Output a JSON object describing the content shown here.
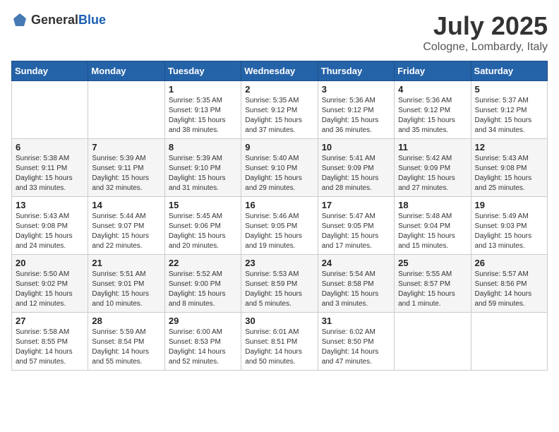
{
  "header": {
    "logo": {
      "general": "General",
      "blue": "Blue"
    },
    "title": "July 2025",
    "location": "Cologne, Lombardy, Italy"
  },
  "calendar": {
    "weekdays": [
      "Sunday",
      "Monday",
      "Tuesday",
      "Wednesday",
      "Thursday",
      "Friday",
      "Saturday"
    ],
    "weeks": [
      [
        {
          "day": "",
          "info": ""
        },
        {
          "day": "",
          "info": ""
        },
        {
          "day": "1",
          "info": "Sunrise: 5:35 AM\nSunset: 9:13 PM\nDaylight: 15 hours\nand 38 minutes."
        },
        {
          "day": "2",
          "info": "Sunrise: 5:35 AM\nSunset: 9:12 PM\nDaylight: 15 hours\nand 37 minutes."
        },
        {
          "day": "3",
          "info": "Sunrise: 5:36 AM\nSunset: 9:12 PM\nDaylight: 15 hours\nand 36 minutes."
        },
        {
          "day": "4",
          "info": "Sunrise: 5:36 AM\nSunset: 9:12 PM\nDaylight: 15 hours\nand 35 minutes."
        },
        {
          "day": "5",
          "info": "Sunrise: 5:37 AM\nSunset: 9:12 PM\nDaylight: 15 hours\nand 34 minutes."
        }
      ],
      [
        {
          "day": "6",
          "info": "Sunrise: 5:38 AM\nSunset: 9:11 PM\nDaylight: 15 hours\nand 33 minutes."
        },
        {
          "day": "7",
          "info": "Sunrise: 5:39 AM\nSunset: 9:11 PM\nDaylight: 15 hours\nand 32 minutes."
        },
        {
          "day": "8",
          "info": "Sunrise: 5:39 AM\nSunset: 9:10 PM\nDaylight: 15 hours\nand 31 minutes."
        },
        {
          "day": "9",
          "info": "Sunrise: 5:40 AM\nSunset: 9:10 PM\nDaylight: 15 hours\nand 29 minutes."
        },
        {
          "day": "10",
          "info": "Sunrise: 5:41 AM\nSunset: 9:09 PM\nDaylight: 15 hours\nand 28 minutes."
        },
        {
          "day": "11",
          "info": "Sunrise: 5:42 AM\nSunset: 9:09 PM\nDaylight: 15 hours\nand 27 minutes."
        },
        {
          "day": "12",
          "info": "Sunrise: 5:43 AM\nSunset: 9:08 PM\nDaylight: 15 hours\nand 25 minutes."
        }
      ],
      [
        {
          "day": "13",
          "info": "Sunrise: 5:43 AM\nSunset: 9:08 PM\nDaylight: 15 hours\nand 24 minutes."
        },
        {
          "day": "14",
          "info": "Sunrise: 5:44 AM\nSunset: 9:07 PM\nDaylight: 15 hours\nand 22 minutes."
        },
        {
          "day": "15",
          "info": "Sunrise: 5:45 AM\nSunset: 9:06 PM\nDaylight: 15 hours\nand 20 minutes."
        },
        {
          "day": "16",
          "info": "Sunrise: 5:46 AM\nSunset: 9:05 PM\nDaylight: 15 hours\nand 19 minutes."
        },
        {
          "day": "17",
          "info": "Sunrise: 5:47 AM\nSunset: 9:05 PM\nDaylight: 15 hours\nand 17 minutes."
        },
        {
          "day": "18",
          "info": "Sunrise: 5:48 AM\nSunset: 9:04 PM\nDaylight: 15 hours\nand 15 minutes."
        },
        {
          "day": "19",
          "info": "Sunrise: 5:49 AM\nSunset: 9:03 PM\nDaylight: 15 hours\nand 13 minutes."
        }
      ],
      [
        {
          "day": "20",
          "info": "Sunrise: 5:50 AM\nSunset: 9:02 PM\nDaylight: 15 hours\nand 12 minutes."
        },
        {
          "day": "21",
          "info": "Sunrise: 5:51 AM\nSunset: 9:01 PM\nDaylight: 15 hours\nand 10 minutes."
        },
        {
          "day": "22",
          "info": "Sunrise: 5:52 AM\nSunset: 9:00 PM\nDaylight: 15 hours\nand 8 minutes."
        },
        {
          "day": "23",
          "info": "Sunrise: 5:53 AM\nSunset: 8:59 PM\nDaylight: 15 hours\nand 5 minutes."
        },
        {
          "day": "24",
          "info": "Sunrise: 5:54 AM\nSunset: 8:58 PM\nDaylight: 15 hours\nand 3 minutes."
        },
        {
          "day": "25",
          "info": "Sunrise: 5:55 AM\nSunset: 8:57 PM\nDaylight: 15 hours\nand 1 minute."
        },
        {
          "day": "26",
          "info": "Sunrise: 5:57 AM\nSunset: 8:56 PM\nDaylight: 14 hours\nand 59 minutes."
        }
      ],
      [
        {
          "day": "27",
          "info": "Sunrise: 5:58 AM\nSunset: 8:55 PM\nDaylight: 14 hours\nand 57 minutes."
        },
        {
          "day": "28",
          "info": "Sunrise: 5:59 AM\nSunset: 8:54 PM\nDaylight: 14 hours\nand 55 minutes."
        },
        {
          "day": "29",
          "info": "Sunrise: 6:00 AM\nSunset: 8:53 PM\nDaylight: 14 hours\nand 52 minutes."
        },
        {
          "day": "30",
          "info": "Sunrise: 6:01 AM\nSunset: 8:51 PM\nDaylight: 14 hours\nand 50 minutes."
        },
        {
          "day": "31",
          "info": "Sunrise: 6:02 AM\nSunset: 8:50 PM\nDaylight: 14 hours\nand 47 minutes."
        },
        {
          "day": "",
          "info": ""
        },
        {
          "day": "",
          "info": ""
        }
      ]
    ]
  }
}
